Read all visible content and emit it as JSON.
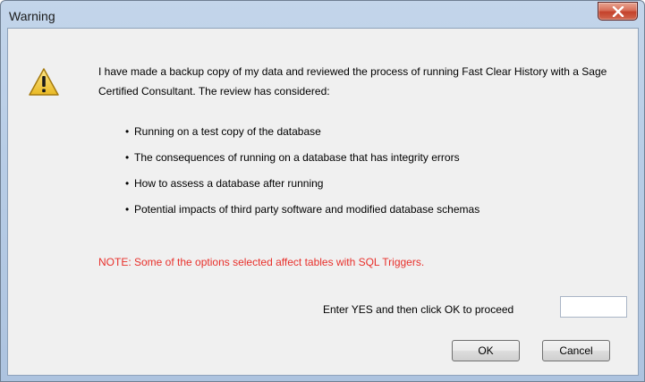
{
  "window": {
    "title": "Warning"
  },
  "message": {
    "intro": "I have made a backup copy of my data and reviewed the process of running Fast Clear History with a Sage Certified Consultant. The review has considered:",
    "bullets": [
      "Running on a test copy of the database",
      "The consequences of running on a database that has integrity errors",
      "How to assess a database after running",
      "Potential impacts of third party software and modified database schemas"
    ],
    "note": "NOTE: Some of the options selected affect tables with SQL Triggers."
  },
  "confirm": {
    "label": "Enter YES and then click OK to proceed",
    "value": ""
  },
  "buttons": {
    "ok": "OK",
    "cancel": "Cancel"
  },
  "icons": {
    "dialog_icon": "warning-icon",
    "close": "close-icon"
  },
  "colors": {
    "note_text": "#e8302b",
    "warning_icon_fill": "#f5d04a"
  }
}
